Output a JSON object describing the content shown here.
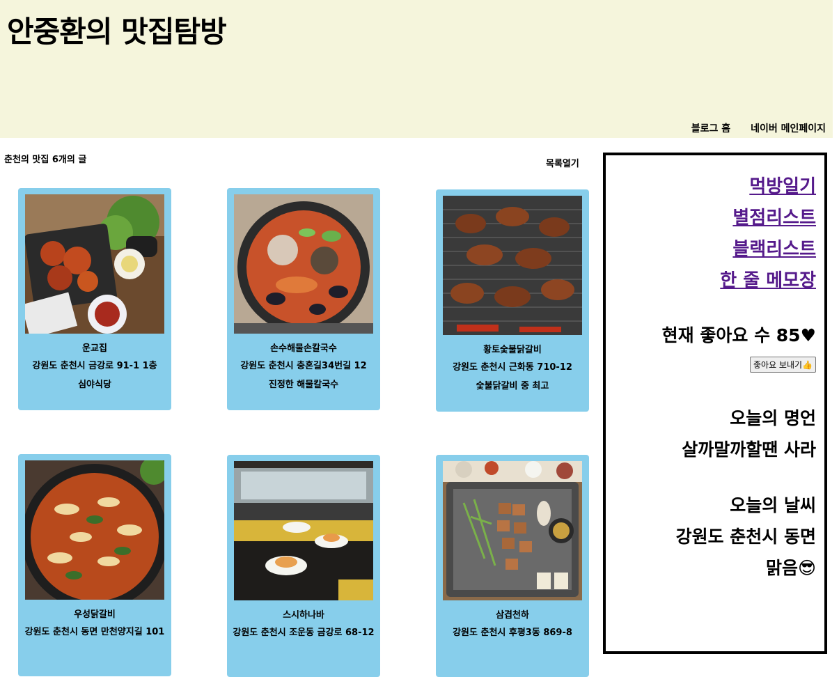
{
  "header": {
    "title": "안중환의 맛집탐방",
    "nav": [
      "블로그 홈",
      "네이버 메인페이지"
    ]
  },
  "list": {
    "count_label": "춘천의 맛집 6개의 글",
    "toggle_label": "목록열기"
  },
  "cards": [
    {
      "name": "운교집",
      "address": "강원도 춘천시 금강로 91-1 1층",
      "note": "심야식당",
      "image": "dakgalbi-plate-image"
    },
    {
      "name": "손수해물손칼국수",
      "address": "강원도 춘천시 충혼길34번길 12",
      "note": "진정한 해물칼국수",
      "image": "seafood-kalguksu-image"
    },
    {
      "name": "황토숯불닭갈비",
      "address": "강원도 춘천시 근화동 710-12",
      "note": "숯불닭갈비 중 최고",
      "image": "charcoal-grill-image"
    },
    {
      "name": "우성닭갈비",
      "address": "강원도 춘천시 동면 만천양지길 101",
      "note": "",
      "image": "dakgalbi-pan-image"
    },
    {
      "name": "스시하나바",
      "address": "강원도 춘천시 조운동 금강로 68-12",
      "note": "",
      "image": "conveyor-sushi-image"
    },
    {
      "name": "삼겹천하",
      "address": "강원도 춘천시 후평3동 869-8",
      "note": "",
      "image": "pork-belly-grill-image"
    }
  ],
  "sidebar": {
    "links": [
      "먹방일기",
      "별점리스트",
      "블랙리스트",
      "한 줄 메모장"
    ],
    "likes": "현재 좋아요 수 85♥",
    "like_button": "좋아요 보내기👍",
    "quote_title": "오늘의 명언",
    "quote": "살까말까할땐 사라",
    "weather_title": "오늘의 날씨",
    "weather_location": "강원도 춘천시 동면",
    "weather_status": "맑음😎"
  },
  "colors": {
    "header_bg": "#f5f5dc",
    "card_bg": "#87ceeb",
    "link": "#551a8b"
  }
}
